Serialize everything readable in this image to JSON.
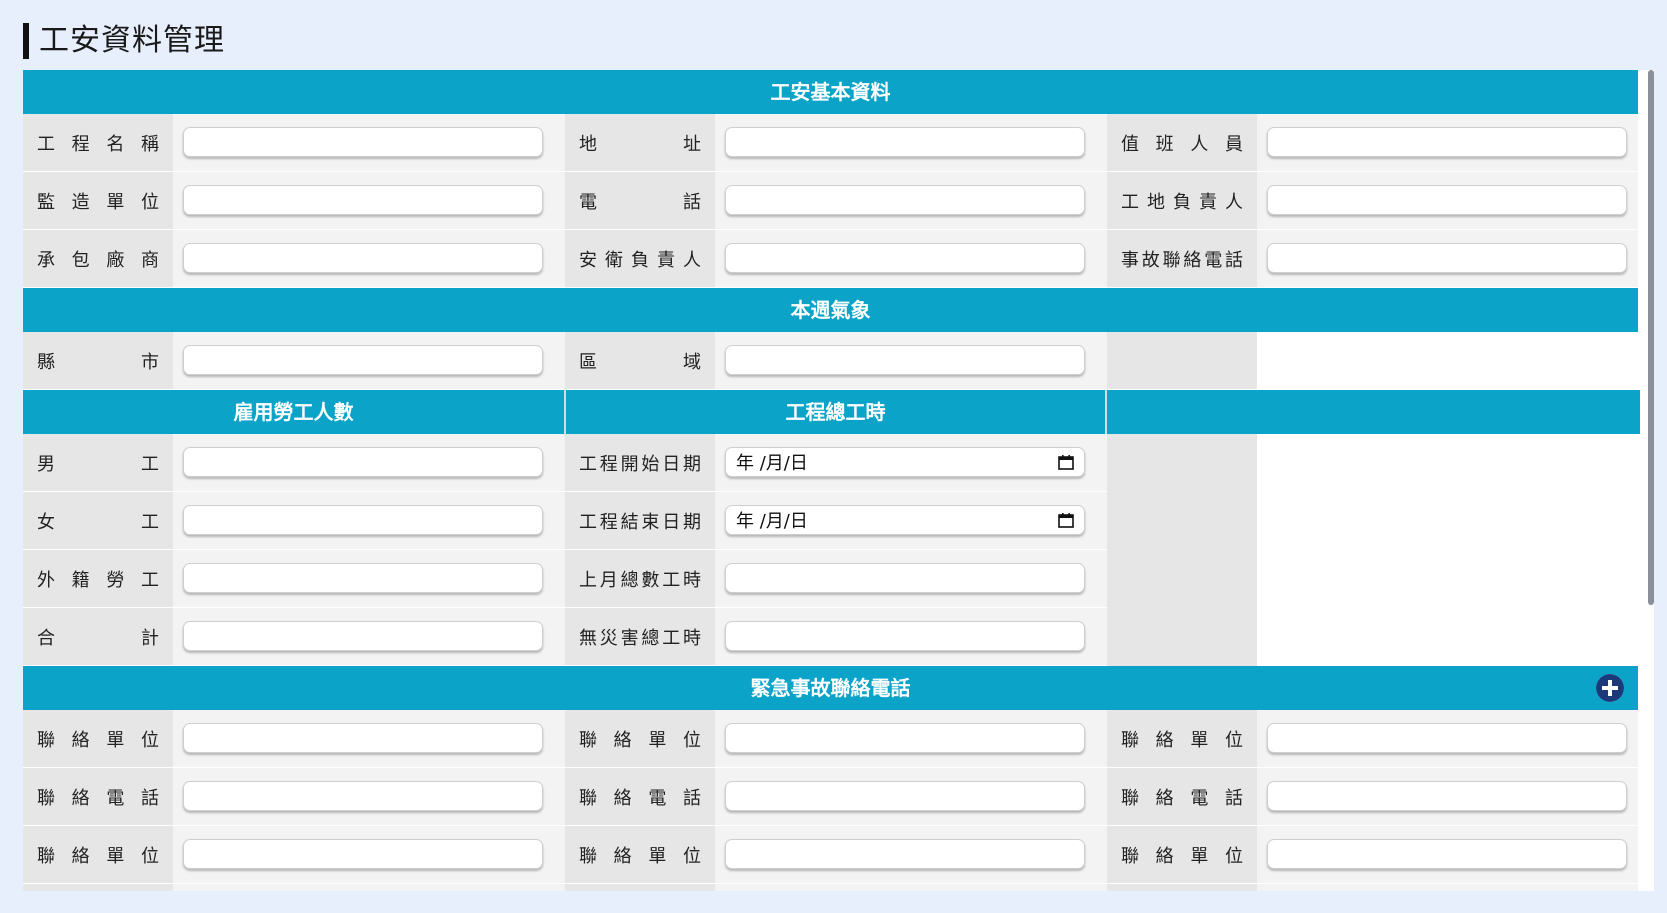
{
  "page": {
    "title": "工安資料管理"
  },
  "basic": {
    "header": "工安基本資料",
    "rows": [
      [
        "工程名稱",
        "地址",
        "值班人員"
      ],
      [
        "監造單位",
        "電話",
        "工地負責人"
      ],
      [
        "承包廠商",
        "安衛負責人",
        "事故聯絡電話"
      ]
    ]
  },
  "weather": {
    "header": "本週氣象",
    "labels": [
      "縣市",
      "區域"
    ]
  },
  "workers": {
    "header": "雇用勞工人數",
    "labels": [
      "男工",
      "女工",
      "外籍勞工",
      "合計"
    ]
  },
  "hours": {
    "header": "工程總工時",
    "labels": [
      "工程開始日期",
      "工程結束日期",
      "上月總數工時",
      "無災害總工時"
    ],
    "date_placeholder": "年 /月/日"
  },
  "emergency": {
    "header": "緊急事故聯絡電話",
    "add_icon": "plus-circle-icon",
    "labels": [
      "聯絡單位",
      "聯絡電話",
      "聯絡單位"
    ]
  },
  "colors": {
    "accent": "#0ba3c8",
    "label_bg": "#e6e6e6",
    "page_bg": "#e7effd"
  }
}
